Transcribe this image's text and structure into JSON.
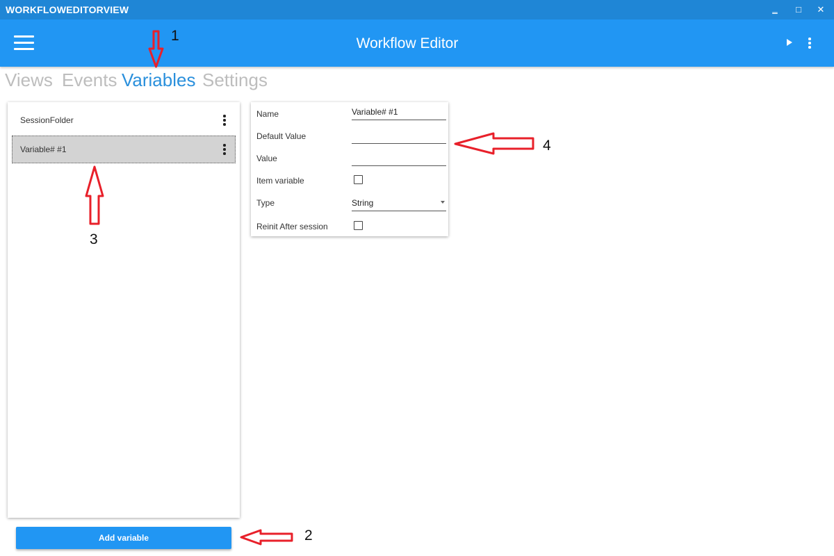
{
  "window": {
    "title": "WORKFLOWEDITORVIEW",
    "controls": {
      "minimize": "‗",
      "maximize": "□",
      "close": "✕"
    }
  },
  "appbar": {
    "title": "Workflow Editor",
    "icons": [
      "hamburger-icon",
      "play-icon",
      "more-vert-icon"
    ]
  },
  "tabs": [
    {
      "label": "Views",
      "active": false
    },
    {
      "label": "Events",
      "active": false
    },
    {
      "label": "Variables",
      "active": true
    },
    {
      "label": "Settings",
      "active": false
    }
  ],
  "variables_list": [
    {
      "label": "SessionFolder",
      "selected": false
    },
    {
      "label": "Variable# #1",
      "selected": true
    }
  ],
  "properties": {
    "name_label": "Name",
    "name_value": "Variable# #1",
    "default_value_label": "Default Value",
    "default_value": "",
    "value_label": "Value",
    "value": "",
    "item_variable_label": "Item variable",
    "item_variable_checked": false,
    "type_label": "Type",
    "type_value": "String",
    "reinit_label": "Reinit After session",
    "reinit_checked": false
  },
  "add_button_label": "Add variable",
  "annotations": {
    "n1": "1",
    "n2": "2",
    "n3": "3",
    "n4": "4",
    "arrow_color": "#e8202a"
  },
  "colors": {
    "titlebar": "#1f86d6",
    "appbar": "#2196f3",
    "active_tab": "#2b90dc",
    "inactive_tab": "#bdbdbd",
    "selected_row": "#d3d3d3"
  }
}
